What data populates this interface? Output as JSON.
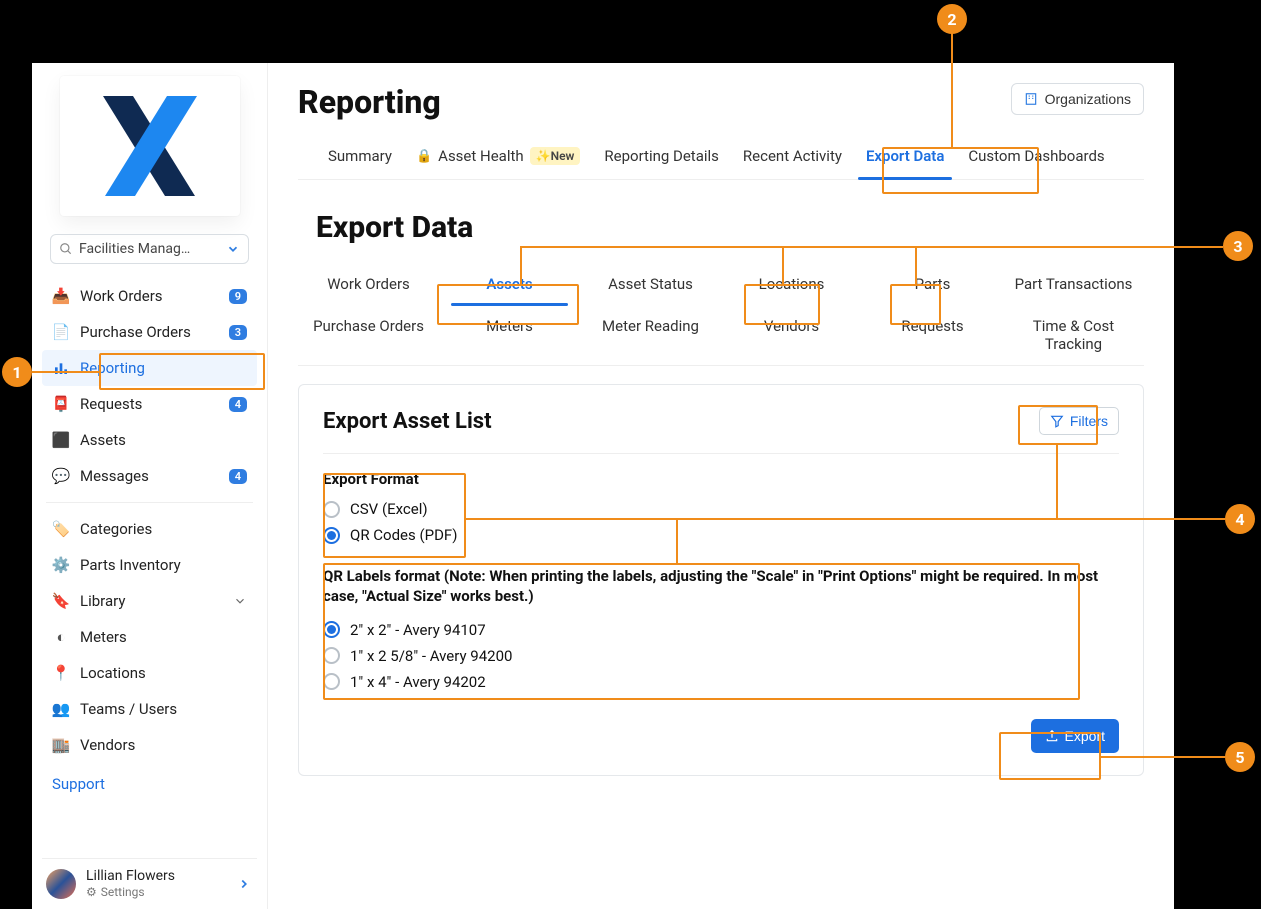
{
  "sidebar": {
    "search_placeholder": "Facilities Manag…",
    "items": [
      {
        "label": "Work Orders",
        "badge": "9"
      },
      {
        "label": "Purchase Orders",
        "badge": "3"
      },
      {
        "label": "Reporting",
        "badge": null
      },
      {
        "label": "Requests",
        "badge": "4"
      },
      {
        "label": "Assets",
        "badge": null
      },
      {
        "label": "Messages",
        "badge": "4"
      }
    ],
    "items2": [
      {
        "label": "Categories"
      },
      {
        "label": "Parts Inventory"
      },
      {
        "label": "Library"
      },
      {
        "label": "Meters"
      },
      {
        "label": "Locations"
      },
      {
        "label": "Teams / Users"
      },
      {
        "label": "Vendors"
      }
    ],
    "support": "Support",
    "user_name": "Lillian Flowers",
    "user_settings": "Settings"
  },
  "header": {
    "title": "Reporting",
    "org_button": "Organizations"
  },
  "tabs": {
    "summary": "Summary",
    "asset_health": "Asset Health",
    "new_label": "New",
    "reporting_details": "Reporting Details",
    "recent_activity": "Recent Activity",
    "export_data": "Export Data",
    "custom_dashboards": "Custom Dashboards"
  },
  "export": {
    "section_title": "Export Data",
    "subtabs_row1": [
      "Work Orders",
      "Assets",
      "Asset Status",
      "Locations",
      "Parts",
      "Part Transactions"
    ],
    "subtabs_row2": [
      "Purchase Orders",
      "Meters",
      "Meter Reading",
      "Vendors",
      "Requests",
      "Time & Cost Tracking"
    ],
    "card_title": "Export Asset List",
    "filters_label": "Filters",
    "format_title": "Export Format",
    "format_options": [
      "CSV (Excel)",
      "QR Codes (PDF)"
    ],
    "qr_note": "QR Labels format (Note: When printing the labels, adjusting the \"Scale\" in \"Print Options\" might be required. In most case, \"Actual Size\" works best.)",
    "qr_options": [
      "2\" x 2\" - Avery 94107",
      "1\" x 2 5/8\" - Avery 94200",
      "1\" x 4\" - Avery 94202"
    ],
    "export_button": "Export"
  },
  "callouts": {
    "n1": "1",
    "n2": "2",
    "n3": "3",
    "n4": "4",
    "n5": "5"
  }
}
